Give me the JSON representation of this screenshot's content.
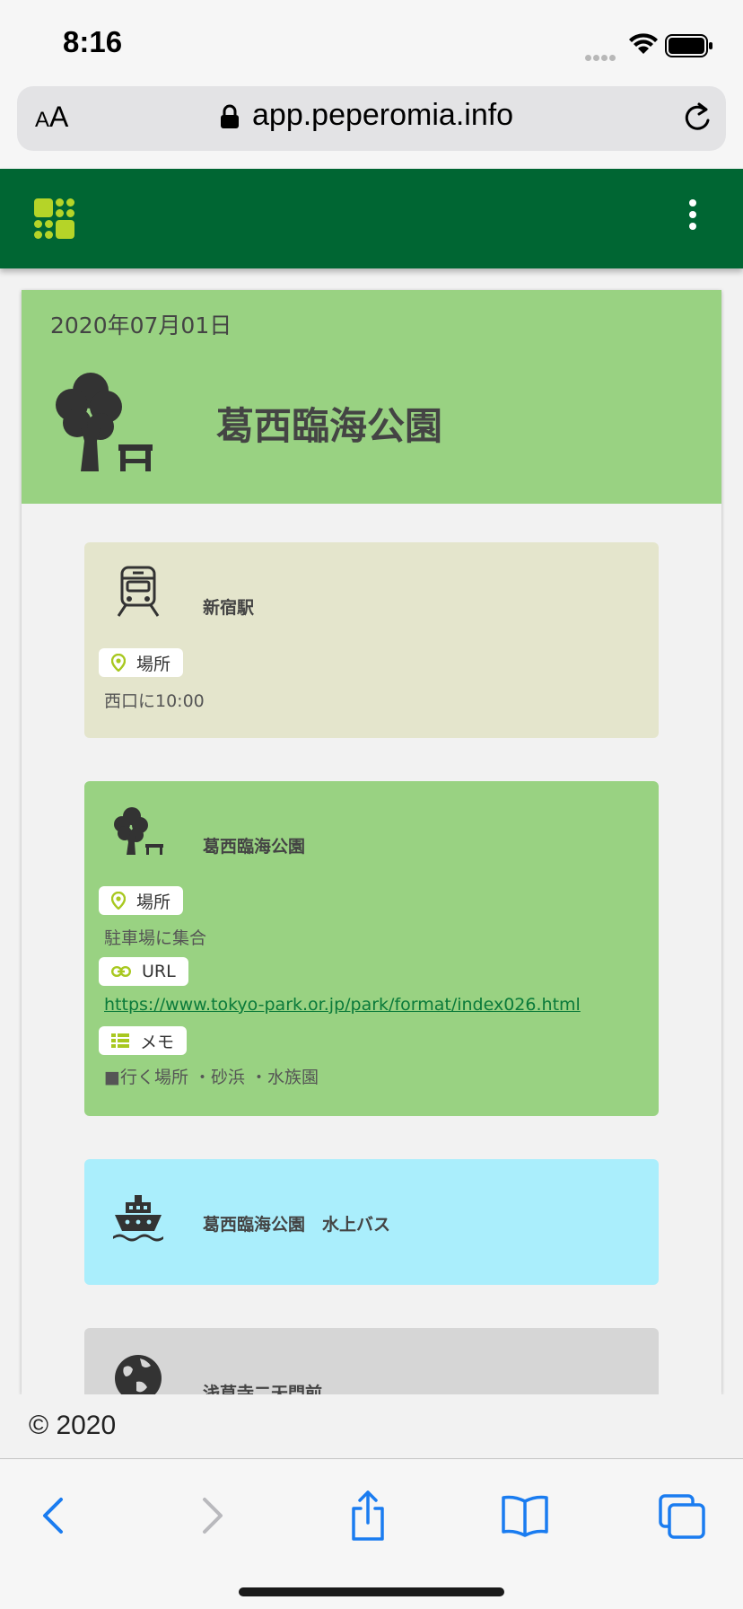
{
  "status_bar": {
    "time": "8:16"
  },
  "browser": {
    "aa_label_small": "A",
    "aa_label_large": "A",
    "url": "app.peperomia.info"
  },
  "colors": {
    "header": "#006633",
    "accent": "#b5d428",
    "hero": "#99d282",
    "station_card": "#e4e5cc",
    "park_card": "#99d282",
    "boat_card": "#aaeefc",
    "globe_card": "#d6d6d6",
    "ios_blue": "#1a7cf0"
  },
  "plan": {
    "date": "2020年07月01日",
    "title": "葛西臨海公園",
    "icon": "park-icon"
  },
  "events": [
    {
      "title": "新宿駅",
      "icon": "train-icon",
      "tags": [
        {
          "label": "場所",
          "icon": "location-pin-icon"
        }
      ],
      "place": "西口に10:00"
    },
    {
      "title": "葛西臨海公園",
      "icon": "park-icon",
      "tags": [
        {
          "label": "場所",
          "icon": "location-pin-icon"
        },
        {
          "label": "URL",
          "icon": "link-icon"
        },
        {
          "label": "メモ",
          "icon": "list-icon"
        }
      ],
      "place": "駐車場に集合",
      "url": "https://www.tokyo-park.or.jp/park/format/index026.html",
      "memo": "■行く場所 ・砂浜 ・水族園"
    },
    {
      "title": "葛西臨海公園　水上バス",
      "icon": "ship-icon"
    },
    {
      "title": "浅草寺二天門前",
      "icon": "globe-icon"
    }
  ],
  "footer": {
    "text": "© 2020"
  }
}
